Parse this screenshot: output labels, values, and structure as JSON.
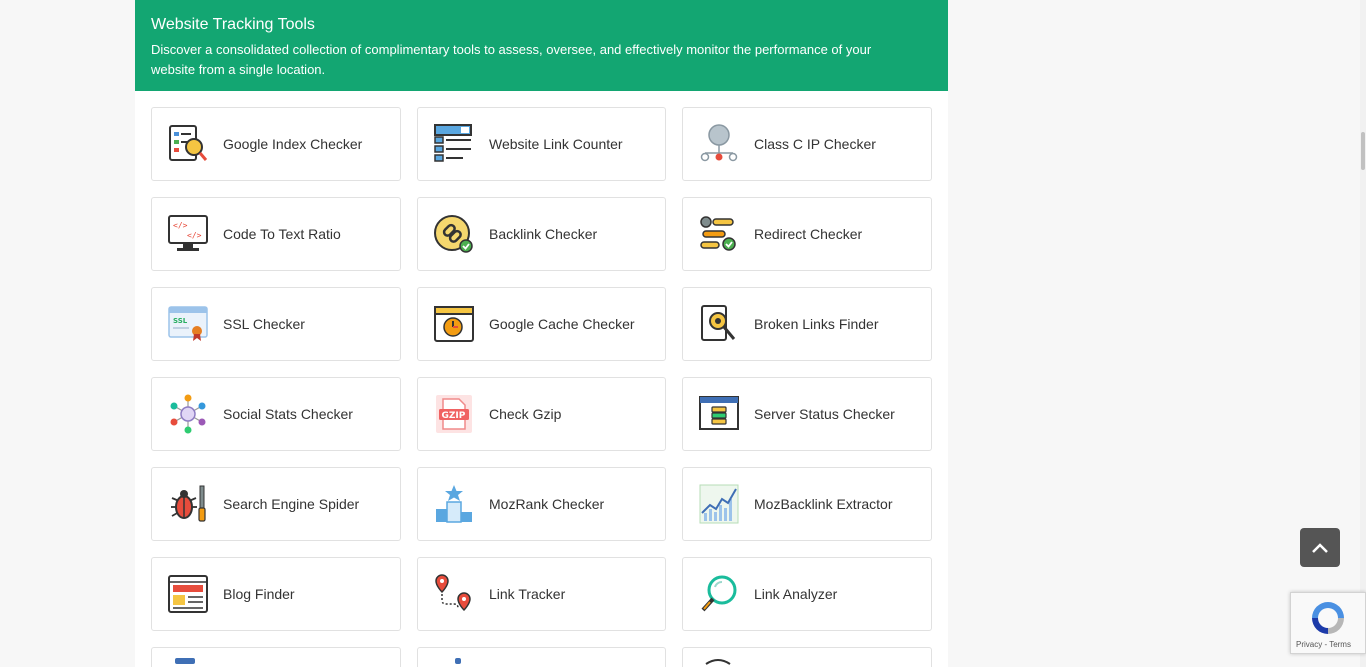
{
  "header": {
    "title": "Website Tracking Tools",
    "description": "Discover a consolidated collection of complimentary tools to assess, oversee, and effectively monitor the performance of your website from a single location."
  },
  "tools": [
    {
      "label": "Google Index Checker",
      "icon": "google-index-checker-icon"
    },
    {
      "label": "Website Link Counter",
      "icon": "website-link-counter-icon"
    },
    {
      "label": "Class C IP Checker",
      "icon": "class-c-ip-checker-icon"
    },
    {
      "label": "Code To Text Ratio",
      "icon": "code-to-text-ratio-icon"
    },
    {
      "label": "Backlink Checker",
      "icon": "backlink-checker-icon"
    },
    {
      "label": "Redirect Checker",
      "icon": "redirect-checker-icon"
    },
    {
      "label": "SSL Checker",
      "icon": "ssl-checker-icon"
    },
    {
      "label": "Google Cache Checker",
      "icon": "google-cache-checker-icon"
    },
    {
      "label": "Broken Links Finder",
      "icon": "broken-links-finder-icon"
    },
    {
      "label": "Social Stats Checker",
      "icon": "social-stats-checker-icon"
    },
    {
      "label": "Check Gzip",
      "icon": "check-gzip-icon"
    },
    {
      "label": "Server Status Checker",
      "icon": "server-status-checker-icon"
    },
    {
      "label": "Search Engine Spider",
      "icon": "search-engine-spider-icon"
    },
    {
      "label": "MozRank Checker",
      "icon": "mozrank-checker-icon"
    },
    {
      "label": "MozBacklink Extractor",
      "icon": "mozbacklink-extractor-icon"
    },
    {
      "label": "Blog Finder",
      "icon": "blog-finder-icon"
    },
    {
      "label": "Link Tracker",
      "icon": "link-tracker-icon"
    },
    {
      "label": "Link Analyzer",
      "icon": "link-analyzer-icon"
    }
  ],
  "recaptcha": {
    "links": "Privacy - Terms"
  },
  "colors": {
    "header_bg": "#13a672",
    "scroll_top_bg": "#555555"
  }
}
